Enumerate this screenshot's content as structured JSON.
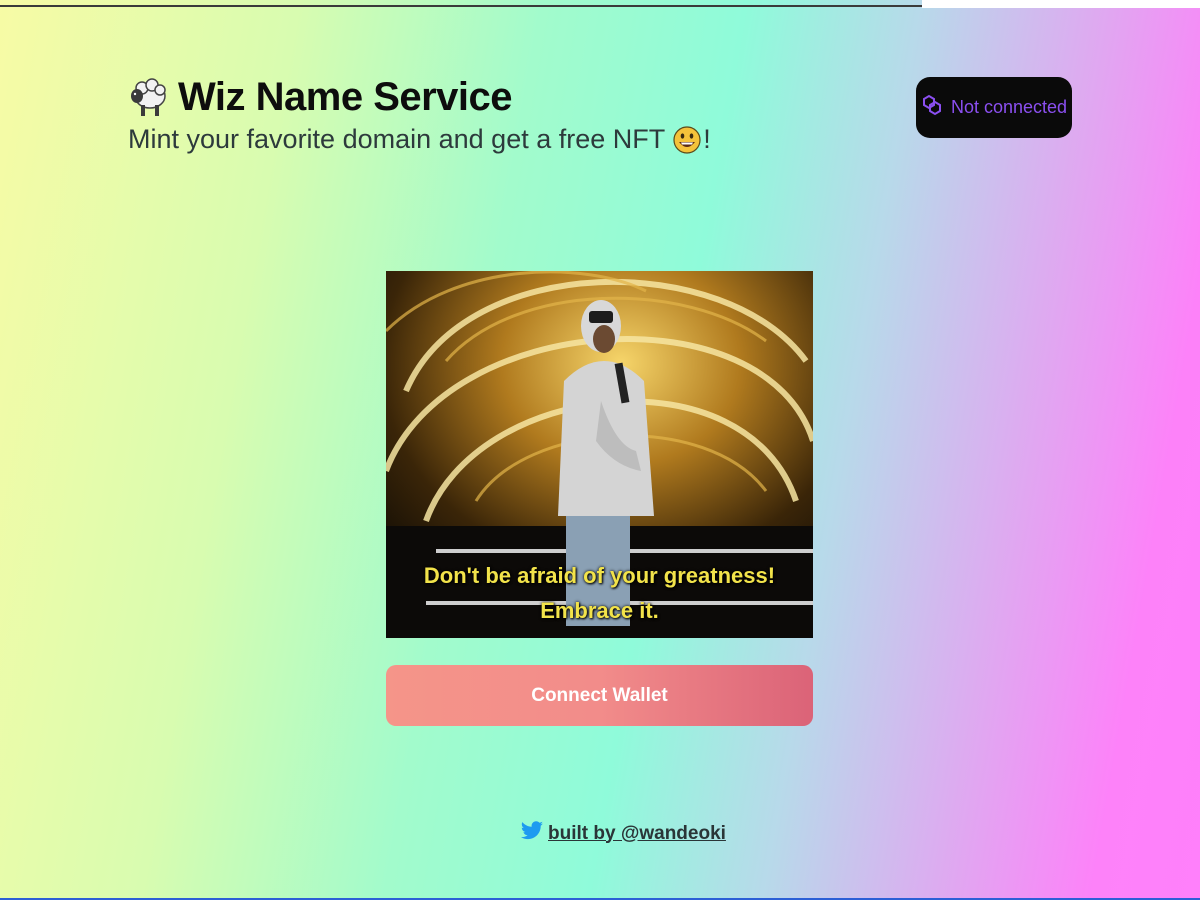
{
  "header": {
    "title": "Wiz Name Service",
    "subtitle_text": "Mint your favorite domain and get a free NFT",
    "subtitle_suffix": "!",
    "logo_icon": "sheep-icon",
    "emoji_icon": "smiling-face-icon"
  },
  "wallet_status": {
    "label": "Not connected",
    "icon": "polygon-link-icon",
    "color": "#8b4ff0"
  },
  "hero_gif": {
    "caption_line1": "Don't be afraid of your greatness!",
    "caption_line2": "Embrace it."
  },
  "connect_button": {
    "label": "Connect Wallet"
  },
  "footer": {
    "icon": "twitter-icon",
    "link_text": "built by @wandeoki"
  },
  "colors": {
    "accent_button": "#f28c8a",
    "status_bg": "#0a0a0a",
    "twitter": "#1d9bf0"
  }
}
